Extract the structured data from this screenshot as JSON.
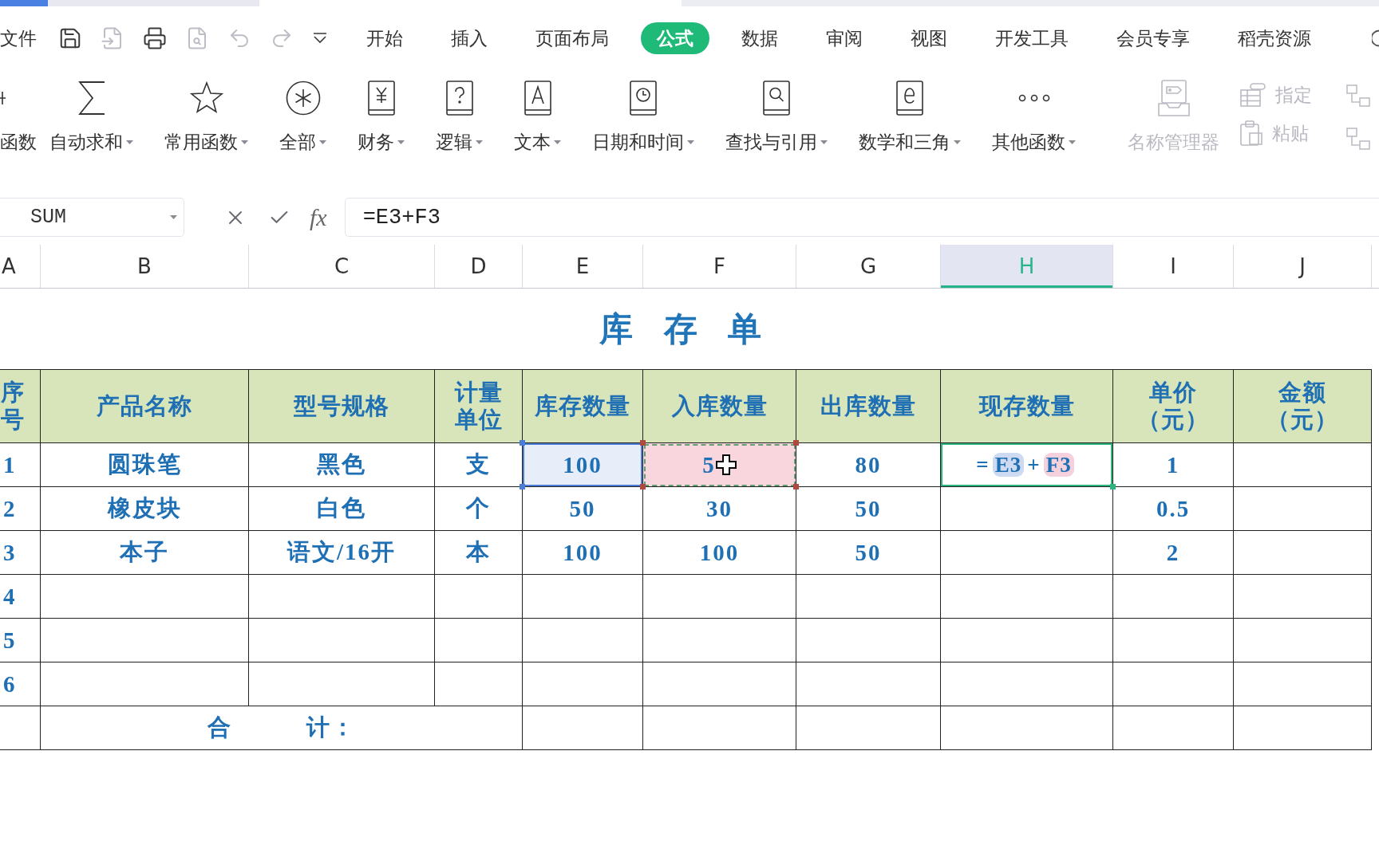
{
  "menu": {
    "file": "文件",
    "quick_access": [
      {
        "disabled": false
      },
      {
        "disabled": true
      },
      {
        "disabled": false
      },
      {
        "disabled": true
      },
      {
        "disabled": true
      },
      {
        "disabled": true
      },
      {
        "disabled": false
      }
    ],
    "tabs": [
      {
        "label": "开始",
        "selected": false
      },
      {
        "label": "插入",
        "selected": false
      },
      {
        "label": "页面布局",
        "selected": false
      },
      {
        "label": "公式",
        "selected": true
      },
      {
        "label": "数据",
        "selected": false
      },
      {
        "label": "审阅",
        "selected": false
      },
      {
        "label": "视图",
        "selected": false
      },
      {
        "label": "开发工具",
        "selected": false
      },
      {
        "label": "会员专享",
        "selected": false
      },
      {
        "label": "稻壳资源",
        "selected": false
      }
    ]
  },
  "ribbon": {
    "items": [
      {
        "label": "函数",
        "dropdown": false,
        "disabled": false
      },
      {
        "label": "自动求和",
        "dropdown": true,
        "disabled": false
      },
      {
        "label": "常用函数",
        "dropdown": true,
        "disabled": false
      },
      {
        "label": "全部",
        "dropdown": true,
        "disabled": false
      },
      {
        "label": "财务",
        "dropdown": true,
        "disabled": false
      },
      {
        "label": "逻辑",
        "dropdown": true,
        "disabled": false
      },
      {
        "label": "文本",
        "dropdown": true,
        "disabled": false
      },
      {
        "label": "日期和时间",
        "dropdown": true,
        "disabled": false
      },
      {
        "label": "查找与引用",
        "dropdown": true,
        "disabled": false
      },
      {
        "label": "数学和三角",
        "dropdown": true,
        "disabled": false
      },
      {
        "label": "其他函数",
        "dropdown": true,
        "disabled": false
      },
      {
        "label": "名称管理器",
        "dropdown": false,
        "disabled": true
      }
    ],
    "stack": [
      {
        "label": "指定",
        "disabled": true
      },
      {
        "label": "粘贴",
        "disabled": true
      }
    ],
    "edge_buttons": [
      {
        "disabled": true
      },
      {
        "disabled": true
      }
    ]
  },
  "formula_bar": {
    "name_box": "SUM",
    "function_label": "fx",
    "formula": "=E3+F3"
  },
  "sheet": {
    "columns": [
      {
        "label": "A",
        "selected": false
      },
      {
        "label": "B",
        "selected": false
      },
      {
        "label": "C",
        "selected": false
      },
      {
        "label": "D",
        "selected": false
      },
      {
        "label": "E",
        "selected": false
      },
      {
        "label": "F",
        "selected": false
      },
      {
        "label": "G",
        "selected": false
      },
      {
        "label": "H",
        "selected": true
      },
      {
        "label": "I",
        "selected": false
      },
      {
        "label": "J",
        "selected": false
      }
    ],
    "title": "库 存 单",
    "header": [
      {
        "lines": [
          "序",
          "号"
        ]
      },
      {
        "lines": [
          "产品名称"
        ]
      },
      {
        "lines": [
          "型号规格"
        ]
      },
      {
        "lines": [
          "计量",
          "单位"
        ]
      },
      {
        "lines": [
          "库存数量"
        ]
      },
      {
        "lines": [
          "入库数量"
        ]
      },
      {
        "lines": [
          "出库数量"
        ]
      },
      {
        "lines": [
          "现存数量"
        ]
      },
      {
        "lines": [
          "单价",
          "（元）"
        ]
      },
      {
        "lines": [
          "金额",
          "（元）"
        ]
      }
    ],
    "rows": [
      {
        "no": "1",
        "name": "圆珠笔",
        "spec": "黑色",
        "unit": "支",
        "stock": {
          "text": "100",
          "color": "#e7edf9",
          "framed": true
        },
        "in": {
          "text": "5",
          "color": "#f9d5dd",
          "marquee": true,
          "cursor": true
        },
        "out": "80",
        "current": {
          "active": true,
          "tokens": [
            {
              "text": "="
            },
            {
              "text": "E3",
              "color": "#cddaf2"
            },
            {
              "text": "+"
            },
            {
              "text": "F3",
              "color": "#f5d0dd"
            }
          ]
        },
        "price": "1"
      },
      {
        "no": "2",
        "name": "橡皮块",
        "spec": "白色",
        "unit": "个",
        "stock": "50",
        "in": "30",
        "out": "50",
        "price": "0.5"
      },
      {
        "no": "3",
        "name": "本子",
        "spec": "语文/16开",
        "unit": "本",
        "stock": "100",
        "in": "100",
        "out": "50",
        "price": "2"
      },
      {
        "no": "4"
      },
      {
        "no": "5"
      },
      {
        "no": "6"
      }
    ],
    "total": {
      "label": "合　　　计："
    }
  }
}
